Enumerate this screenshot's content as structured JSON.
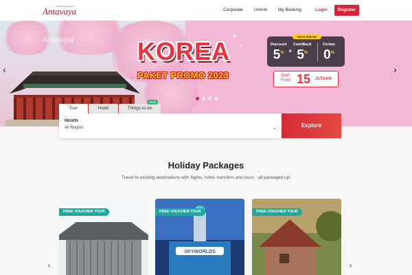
{
  "nav": {
    "logo_tagline": "Indonesia Travel",
    "logo_word": "Antavaya",
    "links": [
      "Corporate",
      "Umroh",
      "My Booking"
    ],
    "login": "Login",
    "register": "Register"
  },
  "hero": {
    "watermark": "Antavaya",
    "headline": "KOREA",
    "subheadline": "PAKET PROMO 2023",
    "promo_pill": "PASTI DISKON",
    "promo": [
      {
        "label": "Discount",
        "value": "5",
        "unit": "%"
      },
      {
        "label": "CashBack",
        "value": "5",
        "unit": "%"
      },
      {
        "label": "Cicilan",
        "value": "0",
        "unit": "%"
      }
    ],
    "start_from": "Start From",
    "price": "15",
    "price_unit": "JUTAAN",
    "slides": 4,
    "active_slide": 1
  },
  "search": {
    "tabs": [
      {
        "label": "Tour",
        "active": true
      },
      {
        "label": "Hotel",
        "active": false
      },
      {
        "label": "Things to do",
        "active": false,
        "badge": "New!"
      }
    ],
    "region_label": "REGION",
    "region_value": "All Region",
    "explore": "Explore"
  },
  "holiday": {
    "title": "Holiday Packages",
    "subtitle": "Travel to exciting destinations with flights, hotel, transfers and tours - all packaged up!",
    "cards": [
      {
        "badge": "FREE VOUCHER TOUR",
        "image": "japanese-temple"
      },
      {
        "badge": "FREE VOUCHER TOUR",
        "image": "skyworlds-theme-park"
      },
      {
        "badge": "FREE VOUCHER TOUR",
        "image": "countryside-cottage"
      }
    ]
  },
  "colors": {
    "brand": "#d6253a",
    "teal": "#22a79b",
    "hero_pink": "#f2b8d6"
  }
}
